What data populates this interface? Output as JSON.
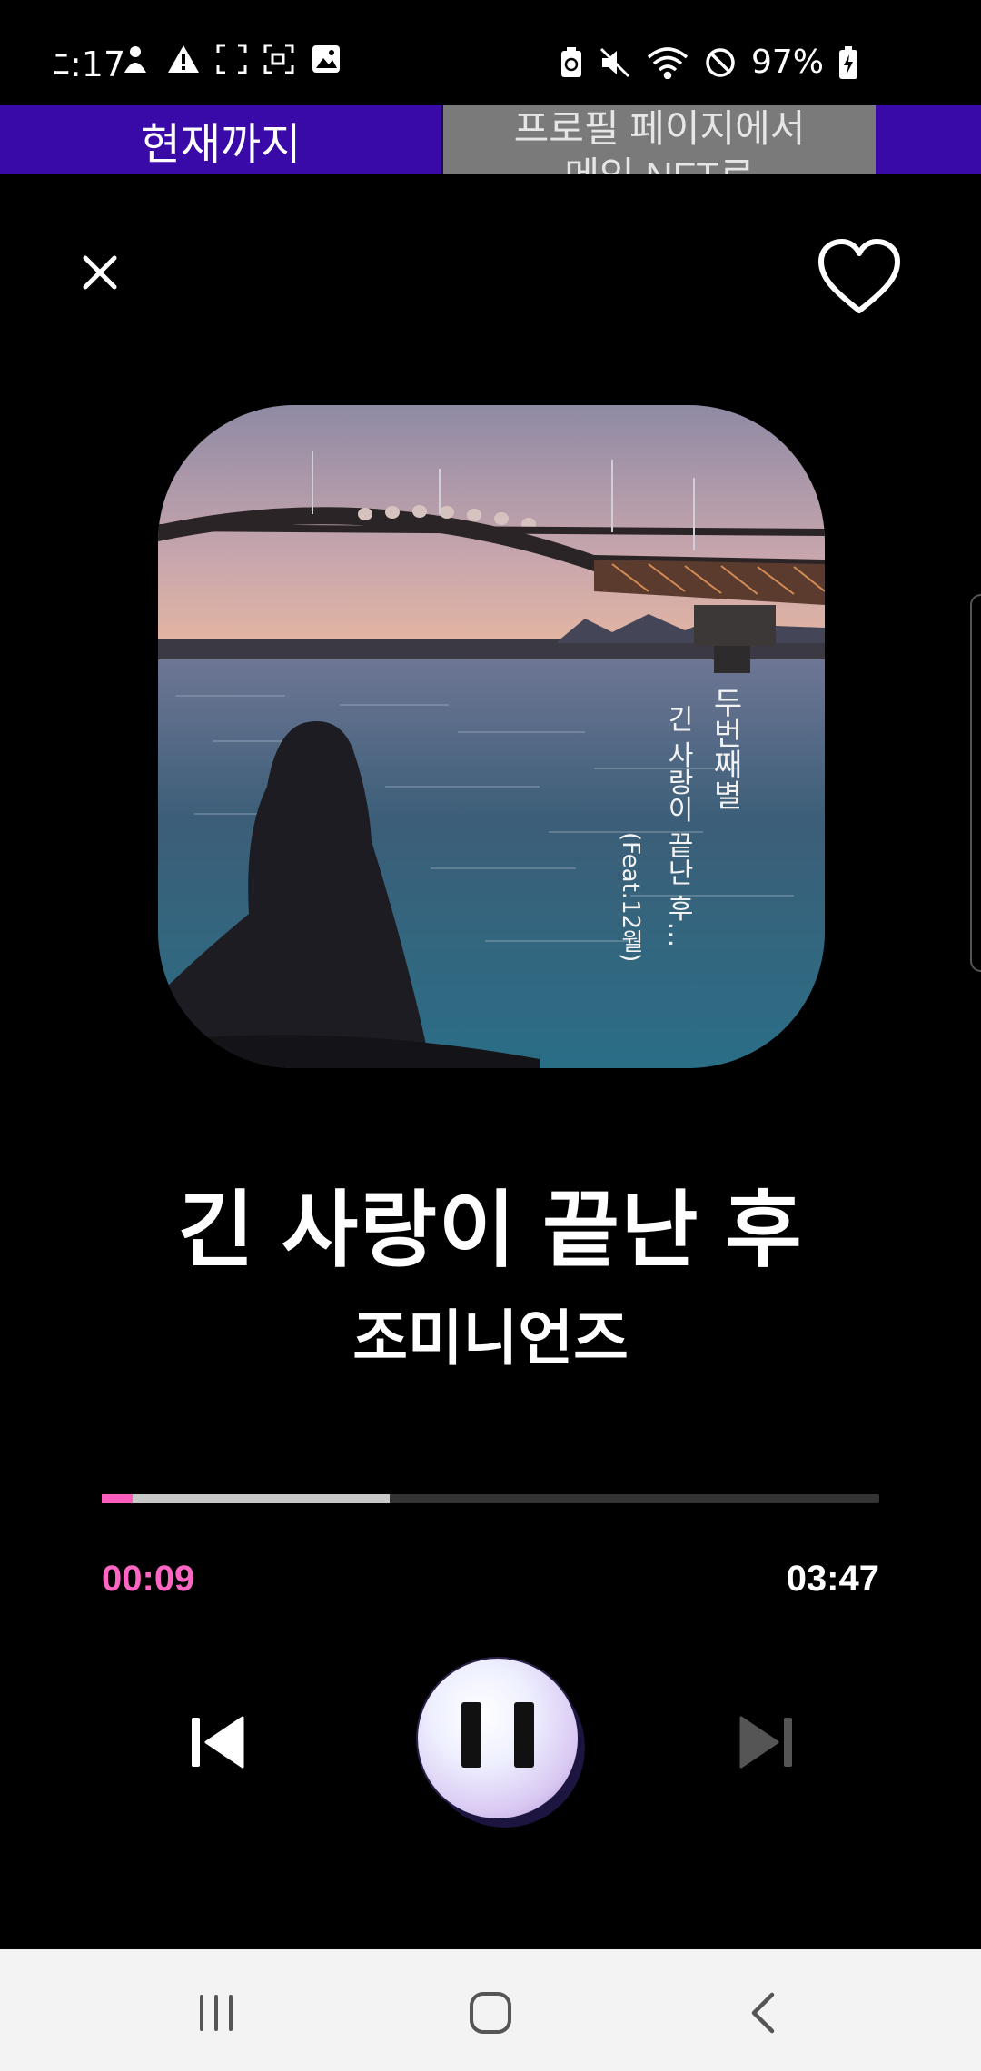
{
  "status_bar": {
    "time": "ﾆ:17",
    "battery_text": "97%",
    "left_icons": [
      "notification-person-icon",
      "warning-icon",
      "screenshot-frame-icon",
      "screen-record-icon",
      "image-icon"
    ],
    "right_icons": [
      "battery-saver-icon",
      "mute-icon",
      "wifi-icon",
      "do-not-disturb-icon",
      "battery-charging-icon"
    ]
  },
  "banner": {
    "left_label": "현재까지",
    "right_line1": "프로필 페이지에서",
    "right_line2": "메인 NFT로"
  },
  "player": {
    "song_title": "긴 사랑이 끝난 후",
    "artist": "조미니언즈",
    "album_art_text": {
      "artist": "두번째별",
      "title": "긴 사랑이 끝난 후...",
      "feat": "(Feat.12월)"
    },
    "current_time": "00:09",
    "total_time": "03:47",
    "progress_fraction": 0.04,
    "buffer_fraction": 0.37,
    "state": "playing"
  },
  "colors": {
    "accent": "#ff5cc0",
    "banner": "#3a0aa8",
    "background": "#000000"
  },
  "nav_bar": {
    "items": [
      "recent-apps-icon",
      "home-icon",
      "back-icon"
    ]
  }
}
